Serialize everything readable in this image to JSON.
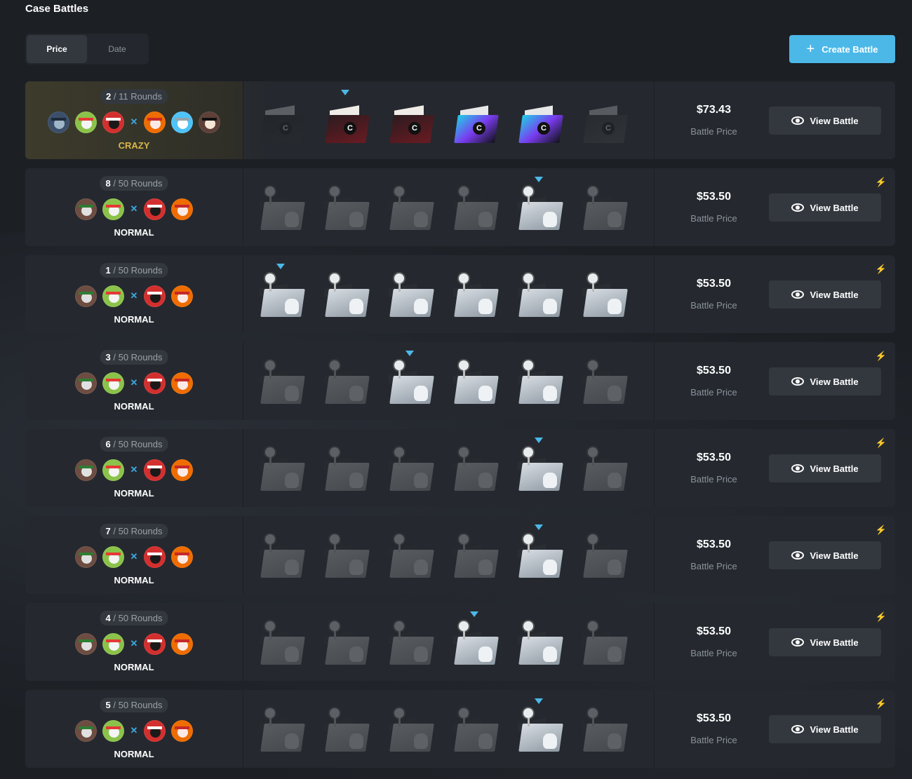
{
  "page": {
    "title": "Case Battles"
  },
  "sort": {
    "options": [
      "Price",
      "Date"
    ],
    "active": "Price"
  },
  "create_button": {
    "label": "Create Battle",
    "icon": "plus-icon"
  },
  "price_label": "Battle Price",
  "view_label": "View Battle",
  "colors": {
    "accent": "#4cb8e8",
    "crazy": "#d9b64a",
    "panel": "#25292f",
    "background": "#1c1f24"
  },
  "battles": [
    {
      "current_round": "2",
      "rounds_text": "/ 11 Rounds",
      "mode": "CRAZY",
      "price": "$73.43",
      "fast": false,
      "team_a": [
        "avatar-soldier",
        "avatar-rasta",
        "avatar-ninja"
      ],
      "team_b": [
        "avatar-fox",
        "avatar-snowman",
        "avatar-sunglasses"
      ],
      "cases": [
        "red",
        "red",
        "red",
        "holo",
        "holo",
        "green"
      ],
      "opened": [
        false,
        true,
        true,
        true,
        true,
        false
      ],
      "active_case": 1
    },
    {
      "current_round": "8",
      "rounds_text": "/ 50 Rounds",
      "mode": "NORMAL",
      "price": "$53.50",
      "fast": true,
      "team_a": [
        "avatar-joker",
        "avatar-rasta"
      ],
      "team_b": [
        "avatar-ninja",
        "avatar-fox"
      ],
      "cases": [
        "white",
        "white",
        "white",
        "white",
        "white",
        "white"
      ],
      "opened": [
        false,
        false,
        false,
        false,
        true,
        false
      ],
      "active_case": 4
    },
    {
      "current_round": "1",
      "rounds_text": "/ 50 Rounds",
      "mode": "NORMAL",
      "price": "$53.50",
      "fast": true,
      "team_a": [
        "avatar-joker",
        "avatar-rasta"
      ],
      "team_b": [
        "avatar-ninja",
        "avatar-fox"
      ],
      "cases": [
        "white",
        "white",
        "white",
        "white",
        "white",
        "white"
      ],
      "opened": [
        true,
        true,
        true,
        true,
        true,
        true
      ],
      "active_case": 0
    },
    {
      "current_round": "3",
      "rounds_text": "/ 50 Rounds",
      "mode": "NORMAL",
      "price": "$53.50",
      "fast": true,
      "team_a": [
        "avatar-joker",
        "avatar-rasta"
      ],
      "team_b": [
        "avatar-ninja",
        "avatar-fox"
      ],
      "cases": [
        "white",
        "white",
        "white",
        "white",
        "white",
        "white"
      ],
      "opened": [
        false,
        false,
        true,
        true,
        true,
        false
      ],
      "active_case": 2
    },
    {
      "current_round": "6",
      "rounds_text": "/ 50 Rounds",
      "mode": "NORMAL",
      "price": "$53.50",
      "fast": true,
      "team_a": [
        "avatar-joker",
        "avatar-rasta"
      ],
      "team_b": [
        "avatar-ninja",
        "avatar-fox"
      ],
      "cases": [
        "white",
        "white",
        "white",
        "white",
        "white",
        "white"
      ],
      "opened": [
        false,
        false,
        false,
        false,
        true,
        false
      ],
      "active_case": 4
    },
    {
      "current_round": "7",
      "rounds_text": "/ 50 Rounds",
      "mode": "NORMAL",
      "price": "$53.50",
      "fast": true,
      "team_a": [
        "avatar-joker",
        "avatar-rasta"
      ],
      "team_b": [
        "avatar-ninja",
        "avatar-fox"
      ],
      "cases": [
        "white",
        "white",
        "white",
        "white",
        "white",
        "white"
      ],
      "opened": [
        false,
        false,
        false,
        false,
        true,
        false
      ],
      "active_case": 4
    },
    {
      "current_round": "4",
      "rounds_text": "/ 50 Rounds",
      "mode": "NORMAL",
      "price": "$53.50",
      "fast": true,
      "team_a": [
        "avatar-joker",
        "avatar-rasta"
      ],
      "team_b": [
        "avatar-ninja",
        "avatar-fox"
      ],
      "cases": [
        "white",
        "white",
        "white",
        "white",
        "white",
        "white"
      ],
      "opened": [
        false,
        false,
        false,
        true,
        true,
        false
      ],
      "active_case": 3
    },
    {
      "current_round": "5",
      "rounds_text": "/ 50 Rounds",
      "mode": "NORMAL",
      "price": "$53.50",
      "fast": true,
      "team_a": [
        "avatar-joker",
        "avatar-rasta"
      ],
      "team_b": [
        "avatar-ninja",
        "avatar-fox"
      ],
      "cases": [
        "white",
        "white",
        "white",
        "white",
        "white",
        "white"
      ],
      "opened": [
        false,
        false,
        false,
        false,
        true,
        false
      ],
      "active_case": 4
    }
  ]
}
